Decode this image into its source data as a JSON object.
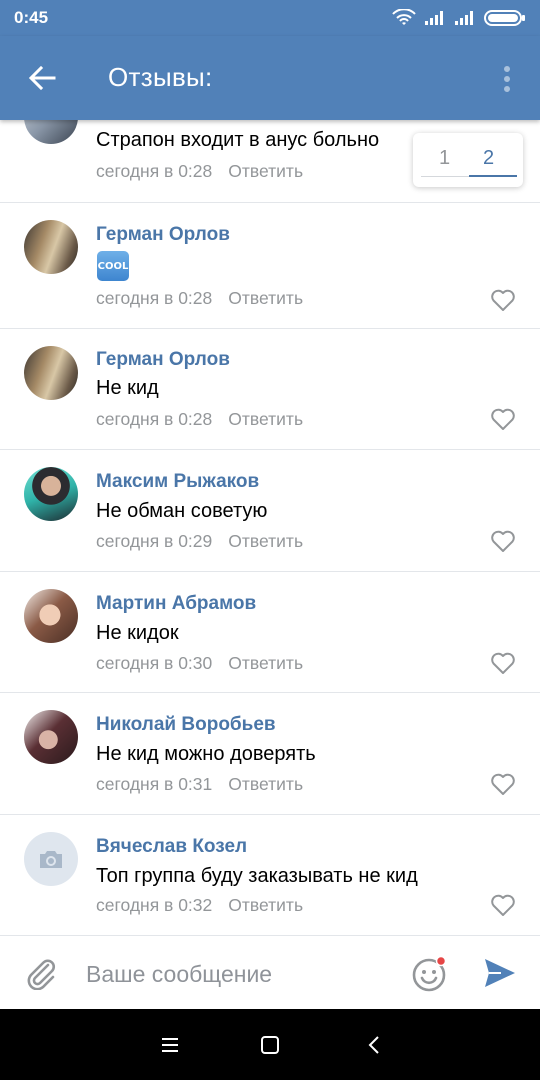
{
  "status_bar": {
    "time": "0:45"
  },
  "header": {
    "title": "Отзывы:"
  },
  "pager": {
    "pages": [
      "1",
      "2"
    ],
    "active": "2"
  },
  "comments": [
    {
      "author": "",
      "text": "Страпон входит в анус больно",
      "time": "сегодня в 0:28",
      "reply": "Ответить",
      "avatar": "photo-office"
    },
    {
      "author": "Герман Орлов",
      "text": "",
      "emoji": "COOL",
      "time": "сегодня в 0:28",
      "reply": "Ответить",
      "avatar": "photo-blonde"
    },
    {
      "author": "Герман Орлов",
      "text": "Не кид",
      "time": "сегодня в 0:28",
      "reply": "Ответить",
      "avatar": "photo-blonde"
    },
    {
      "author": "Максим Рыжаков",
      "text": "Не обман советую",
      "time": "сегодня в 0:29",
      "reply": "Ответить",
      "avatar": "photo-boy-teal"
    },
    {
      "author": "Мартин Абрамов",
      "text": "Не кидок",
      "time": "сегодня в 0:30",
      "reply": "Ответить",
      "avatar": "photo-girl"
    },
    {
      "author": "Николай Воробьев",
      "text": "Не кид можно доверять",
      "time": "сегодня в 0:31",
      "reply": "Ответить",
      "avatar": "photo-boy-dark"
    },
    {
      "author": "Вячеслав Козел",
      "text": "Топ группа буду заказывать не кид",
      "time": "сегодня в 0:32",
      "reply": "Ответить",
      "avatar": "camera-placeholder"
    }
  ],
  "composer": {
    "placeholder": "Ваше сообщение"
  },
  "colors": {
    "header": "#5181b8",
    "link": "#4a76a8",
    "meta": "#939699",
    "notify": "#e64646"
  }
}
